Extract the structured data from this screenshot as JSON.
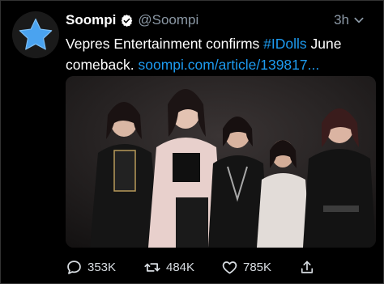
{
  "tweet": {
    "display_name": "Soompi",
    "handle": "@Soompi",
    "time": "3h",
    "text_plain": "Vepres Entertainment confirms ",
    "hashtag": "#IDolls",
    "text_after_hashtag": " June",
    "line2_plain": "comeback. ",
    "link_text": "soompi.com/article/139817...",
    "avatar_icon": "star-icon",
    "verified_icon": "verified-badge-icon"
  },
  "actions": {
    "replies": "353K",
    "retweets": "484K",
    "likes": "785K"
  },
  "colors": {
    "background": "#000000",
    "link": "#1d9bf0",
    "muted": "#8b98a5",
    "star": "#4aa3f0"
  }
}
